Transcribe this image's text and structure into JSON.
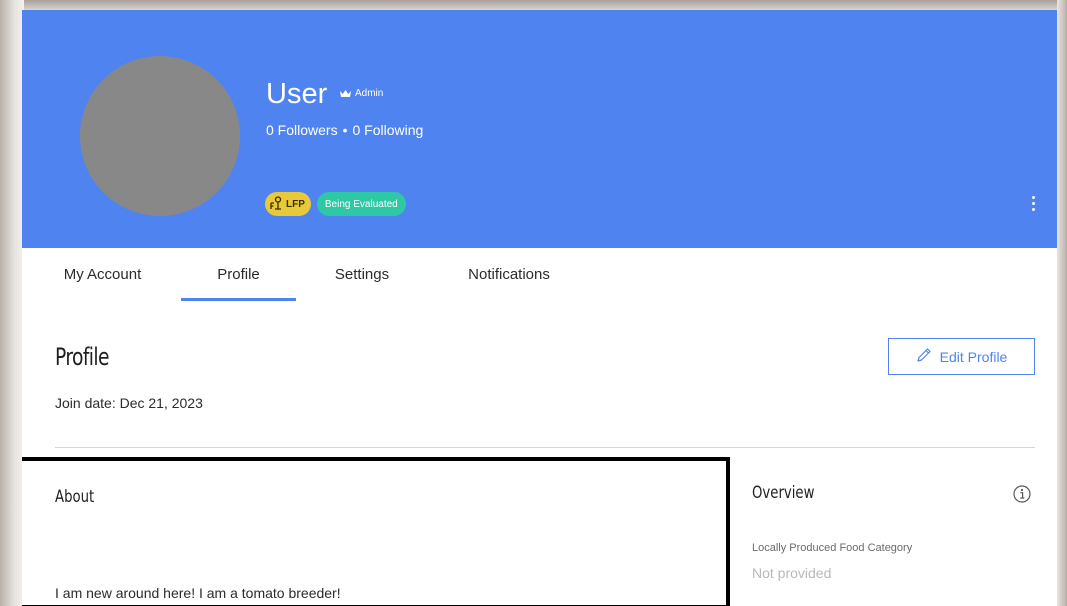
{
  "header": {
    "user_name": "User",
    "role": "Admin",
    "followers": "0 Followers",
    "separator": "•",
    "following": "0 Following",
    "badges": {
      "lfp": "LFP",
      "status": "Being Evaluated"
    },
    "more_icon": "vertical-ellipsis-icon",
    "colors": {
      "cover": "#4f84f0",
      "lfp_badge": "#e8c93a",
      "status_badge": "#2ec9a4"
    }
  },
  "tabs": [
    {
      "label": "My Account"
    },
    {
      "label": "Profile",
      "active": true
    },
    {
      "label": "Settings"
    },
    {
      "label": "Notifications"
    }
  ],
  "profile": {
    "title": "Profile",
    "join_date": "Join date: Dec 21, 2023",
    "edit_label": "Edit Profile",
    "edit_icon": "pencil-icon"
  },
  "about": {
    "title": "About",
    "text": "I am new around here! I am a tomato breeder!"
  },
  "overview": {
    "title": "Overview",
    "info_icon": "info-icon",
    "category_label": "Locally Produced Food Category",
    "category_value": "Not provided"
  }
}
